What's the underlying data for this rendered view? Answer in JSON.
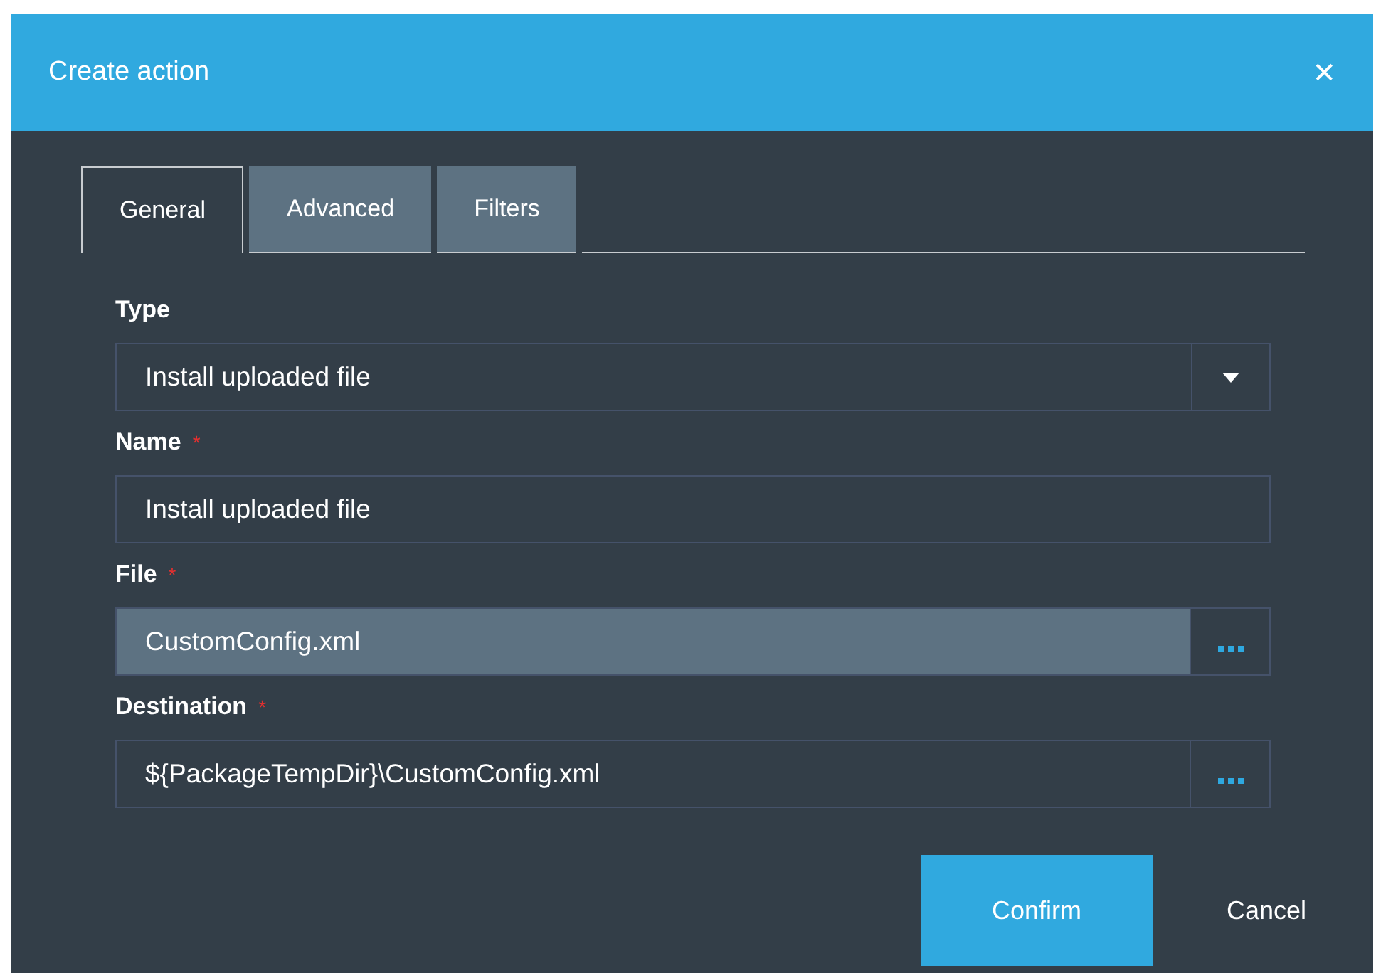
{
  "dialog": {
    "title": "Create action",
    "close": "✕"
  },
  "tabs": [
    {
      "label": "General",
      "selected": true
    },
    {
      "label": "Advanced",
      "selected": false
    },
    {
      "label": "Filters",
      "selected": false
    }
  ],
  "fields": [
    {
      "kind": "select",
      "label": "Type",
      "value": "Install uploaded file"
    },
    {
      "kind": "text",
      "label": "Name",
      "required_mark": "*",
      "value": "Install uploaded file"
    },
    {
      "kind": "browse",
      "label": "File",
      "required_mark": "*",
      "value": "CustomConfig.xml",
      "highlighted": true
    },
    {
      "kind": "browse",
      "label": "Destination",
      "required_mark": "*",
      "value": "${PackageTempDir}\\CustomConfig.xml",
      "highlighted": false
    }
  ],
  "buttons": {
    "confirm": "Confirm",
    "cancel": "Cancel"
  }
}
